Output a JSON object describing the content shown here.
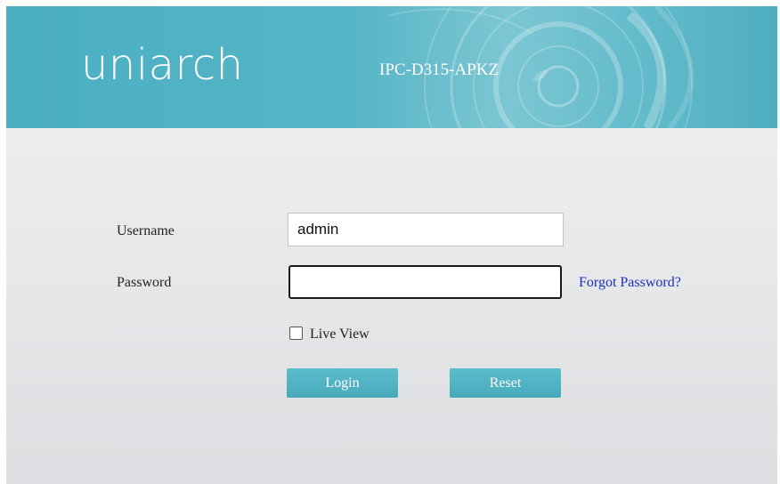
{
  "brand": {
    "logo_text": "uniarch",
    "model": "IPC-D315-APKZ"
  },
  "form": {
    "username_label": "Username",
    "username_value": "admin",
    "password_label": "Password",
    "password_value": "",
    "forgot_link": "Forgot Password?",
    "live_view_label": "Live View",
    "live_view_checked": false,
    "login_button": "Login",
    "reset_button": "Reset"
  },
  "colors": {
    "header": "#4aafc2",
    "button": "#4fb3c3",
    "link": "#1a2fc0"
  },
  "icons": {
    "header_decoration": "camera-lens-graphic"
  }
}
